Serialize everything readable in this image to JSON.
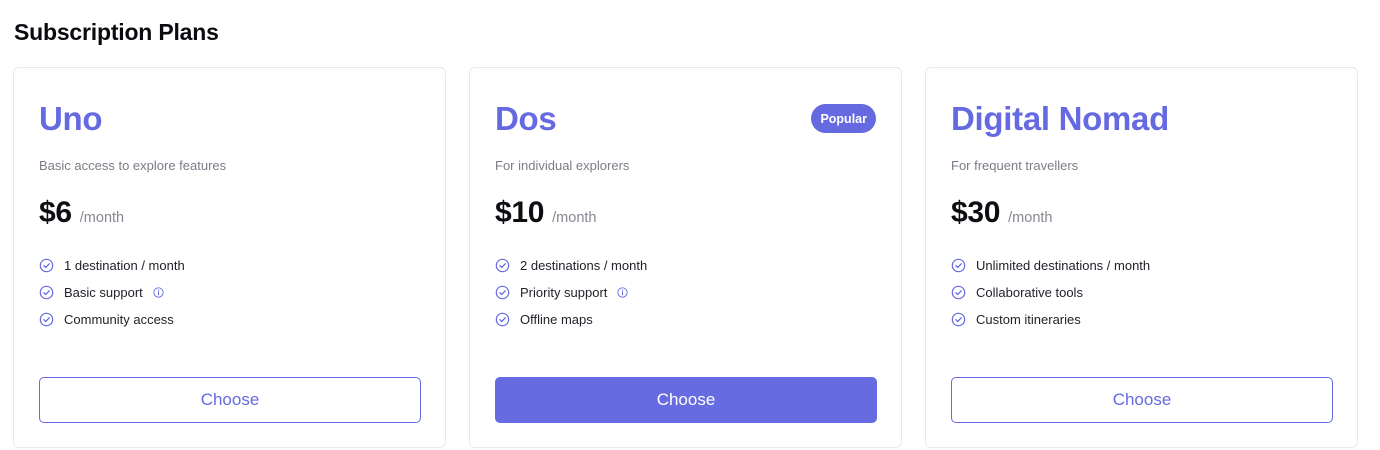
{
  "page": {
    "title": "Subscription Plans"
  },
  "colors": {
    "accent": "#666ae0",
    "accent_button": "#666be0",
    "muted": "#7a7d86"
  },
  "icons": {
    "feature": "check-circle-icon",
    "info": "info-icon"
  },
  "plans": [
    {
      "name": "Uno",
      "description": "Basic access to explore features",
      "price": "$6",
      "period": "/month",
      "features": [
        {
          "label": "1 destination / month",
          "info": false
        },
        {
          "label": "Basic support",
          "info": true
        },
        {
          "label": "Community access",
          "info": false
        }
      ],
      "button": {
        "label": "Choose",
        "style": "outline"
      }
    },
    {
      "name": "Dos",
      "badge": "Popular",
      "description": "For individual explorers",
      "price": "$10",
      "period": "/month",
      "features": [
        {
          "label": "2 destinations / month",
          "info": false
        },
        {
          "label": "Priority support",
          "info": true
        },
        {
          "label": "Offline maps",
          "info": false
        }
      ],
      "button": {
        "label": "Choose",
        "style": "filled"
      }
    },
    {
      "name": "Digital Nomad",
      "description": "For frequent travellers",
      "price": "$30",
      "period": "/month",
      "features": [
        {
          "label": "Unlimited destinations / month",
          "info": false
        },
        {
          "label": "Collaborative tools",
          "info": false
        },
        {
          "label": "Custom itineraries",
          "info": false
        }
      ],
      "button": {
        "label": "Choose",
        "style": "outline"
      }
    }
  ]
}
